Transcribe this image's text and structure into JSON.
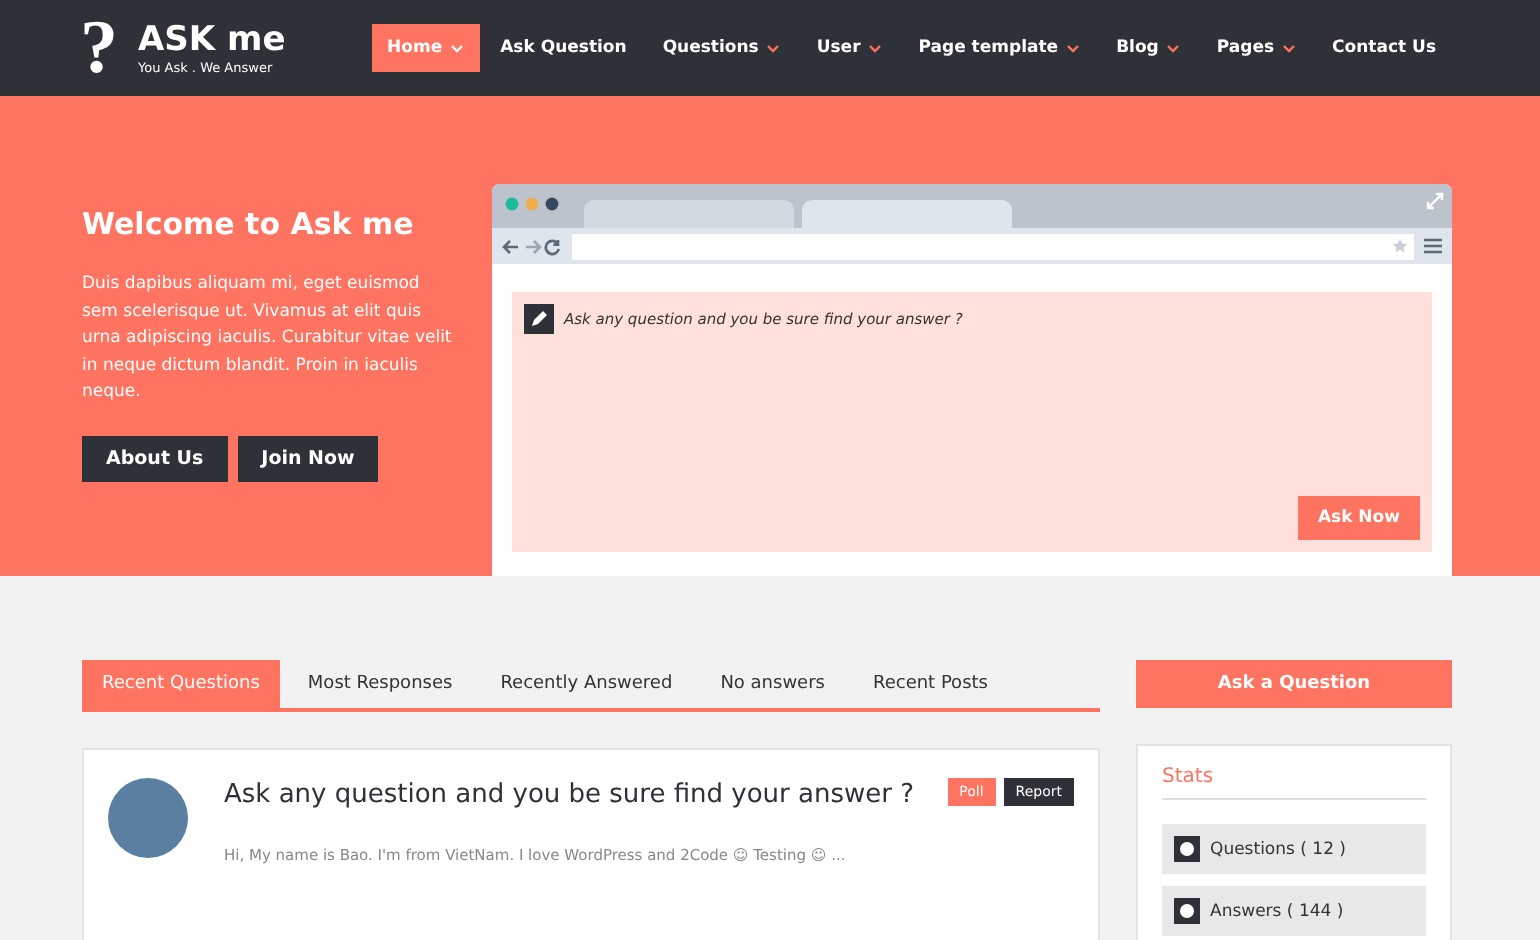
{
  "logo": {
    "mark": "?",
    "name": "ASK me",
    "tagline": "You Ask . We Answer"
  },
  "nav": [
    {
      "label": "Home",
      "selected": true,
      "caret": true
    },
    {
      "label": "Ask Question",
      "selected": false,
      "caret": false
    },
    {
      "label": "Questions",
      "selected": false,
      "caret": true
    },
    {
      "label": "User",
      "selected": false,
      "caret": true
    },
    {
      "label": "Page template",
      "selected": false,
      "caret": true
    },
    {
      "label": "Blog",
      "selected": false,
      "caret": true
    },
    {
      "label": "Pages",
      "selected": false,
      "caret": true
    },
    {
      "label": "Contact Us",
      "selected": false,
      "caret": false
    }
  ],
  "hero": {
    "title": "Welcome to Ask me",
    "text": "Duis dapibus aliquam mi, eget euismod sem scelerisque ut. Vivamus at elit quis urna adipiscing iaculis. Curabitur vitae velit in neque dictum blandit. Proin in iaculis neque.",
    "buttons": [
      "About Us",
      "Join Now"
    ],
    "browser": {
      "question": {
        "placeholder": "Ask any question and you be sure find your answer ?"
      },
      "submit": "Ask Now"
    }
  },
  "tabs": [
    {
      "label": "Recent Questions",
      "selected": true
    },
    {
      "label": "Most Responses",
      "selected": false
    },
    {
      "label": "Recently Answered",
      "selected": false
    },
    {
      "label": "No answers",
      "selected": false
    },
    {
      "label": "Recent Posts",
      "selected": false
    }
  ],
  "question": {
    "title": "Ask any question and you be sure find your answer ?",
    "badges": [
      {
        "label": "Poll",
        "kind": "poll"
      },
      {
        "label": "Report",
        "kind": "report"
      }
    ],
    "excerpt": "Hi, My name is Bao. I'm from VietNam. I love WordPress and 2Code ☺ Testing ☺ ..."
  },
  "sidebar": {
    "ask_button": "Ask a Question",
    "stats": {
      "title": "Stats",
      "items": [
        "Questions ( 12 )",
        "Answers ( 144 )"
      ]
    }
  }
}
